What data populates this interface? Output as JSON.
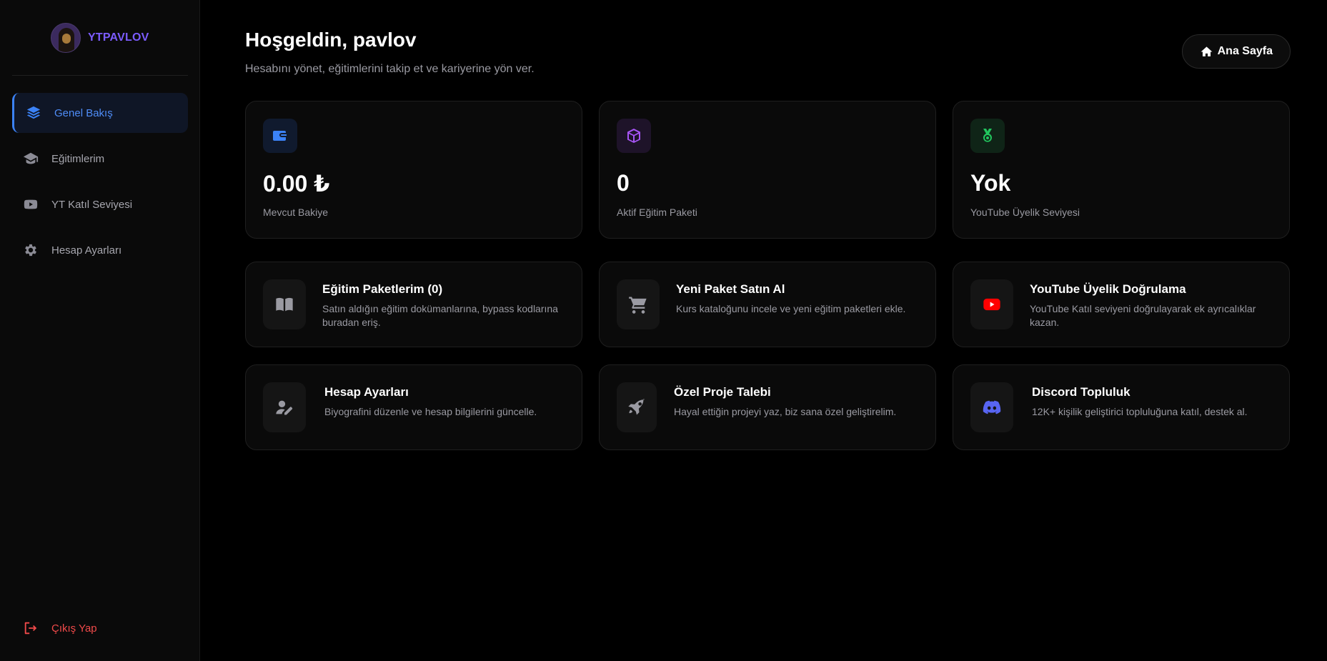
{
  "sidebar": {
    "brand": "YTPAVLOV",
    "items": [
      {
        "label": "Genel Bakış",
        "icon": "layers-icon",
        "active": true
      },
      {
        "label": "Eğitimlerim",
        "icon": "graduation-cap-icon",
        "active": false
      },
      {
        "label": "YT Katıl Seviyesi",
        "icon": "youtube-icon",
        "active": false
      },
      {
        "label": "Hesap Ayarları",
        "icon": "gear-icon",
        "active": false
      }
    ],
    "logout": "Çıkış Yap"
  },
  "header": {
    "title": "Hoşgeldin, pavlov",
    "subtitle": "Hesabını yönet, eğitimlerini takip et ve kariyerine yön ver.",
    "home_button": "Ana Sayfa"
  },
  "stats": [
    {
      "value": "0.00 ₺",
      "label": "Mevcut Bakiye",
      "icon": "wallet-icon",
      "color": "#3b82f6",
      "bg": "#101a2e"
    },
    {
      "value": "0",
      "label": "Aktif Eğitim Paketi",
      "icon": "cube-icon",
      "color": "#a855f7",
      "bg": "#1e1329"
    },
    {
      "value": "Yok",
      "label": "YouTube Üyelik Seviyesi",
      "icon": "medal-icon",
      "color": "#22c55e",
      "bg": "#0f2417"
    }
  ],
  "cards": [
    {
      "title": "Eğitim Paketlerim (0)",
      "desc": "Satın aldığın eğitim dokümanlarına, bypass kodlarına buradan eriş.",
      "icon": "book-icon"
    },
    {
      "title": "Yeni Paket Satın Al",
      "desc": "Kurs kataloğunu incele ve yeni eğitim paketleri ekle.",
      "icon": "cart-icon"
    },
    {
      "title": "YouTube Üyelik Doğrulama",
      "desc": "YouTube Katıl seviyeni doğrulayarak ek ayrıcalıklar kazan.",
      "icon": "youtube-icon"
    },
    {
      "title": "Hesap Ayarları",
      "desc": "Biyografini düzenle ve hesap bilgilerini güncelle.",
      "icon": "user-edit-icon"
    },
    {
      "title": "Özel Proje Talebi",
      "desc": "Hayal ettiğin projeyi yaz, biz sana özel geliştirelim.",
      "icon": "rocket-icon"
    },
    {
      "title": "Discord Topluluk",
      "desc": "12K+ kişilik geliştirici topluluğuna katıl, destek al.",
      "icon": "discord-icon"
    }
  ],
  "colors": {
    "accent": "#3b82f6",
    "brand": "#7c5cff",
    "danger": "#f04a4a",
    "youtube": "#ff0000",
    "discord": "#5865f2"
  }
}
